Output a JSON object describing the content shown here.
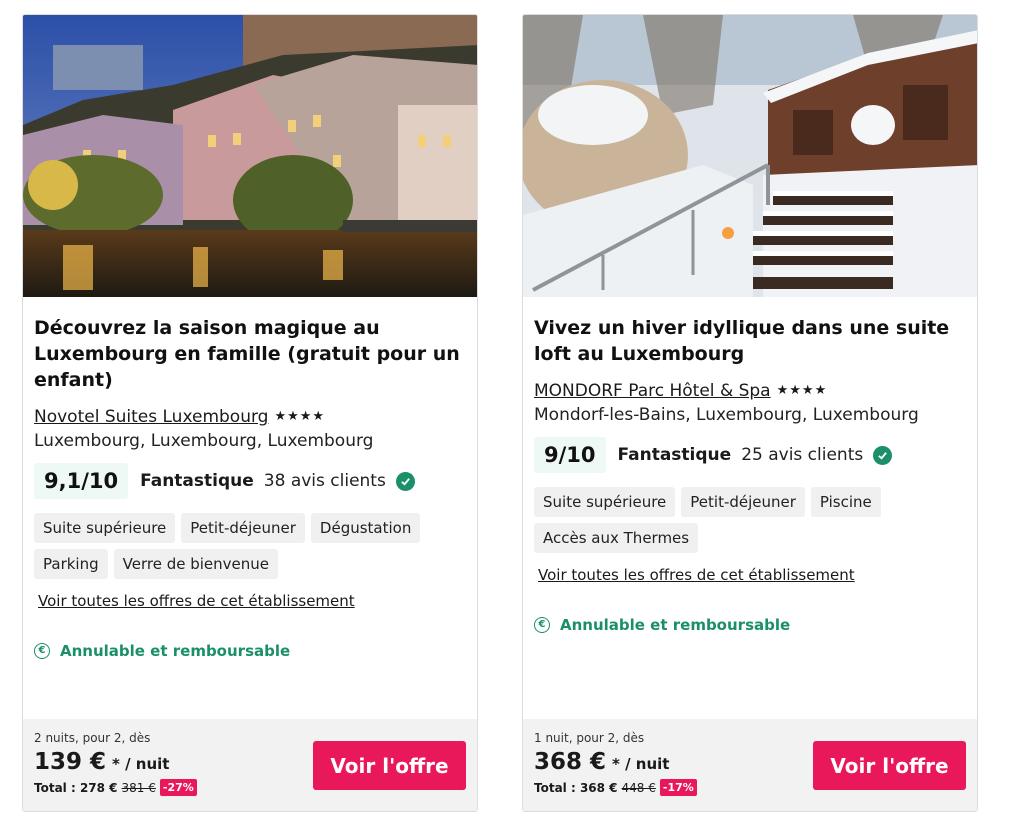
{
  "cards": [
    {
      "title": "Découvrez la saison magique au Luxembourg en famille (gratuit pour un enfant)",
      "hotel_name": "Novotel Suites Luxembourg",
      "stars": "★★★★",
      "location": "Luxembourg, Luxembourg, Luxembourg",
      "score": "9,1/10",
      "verdict": "Fantastique",
      "reviews": "38 avis clients",
      "tags": [
        "Suite supérieure",
        "Petit-déjeuner",
        "Dégustation",
        "Parking",
        "Verre de bienvenue"
      ],
      "offers_link": "Voir toutes les offres de cet établissement",
      "refund": "Annulable et remboursable",
      "stay": "2 nuits, pour 2, dès",
      "price": "139 €",
      "per_night": "* / nuit",
      "total_label": "Total : 278 €",
      "old_price": "381 €",
      "discount": "-27%",
      "cta": "Voir l'offre"
    },
    {
      "title": "Vivez un hiver idyllique dans une suite loft au Luxembourg",
      "hotel_name": "MONDORF Parc Hôtel & Spa",
      "stars": "★★★★",
      "location": "Mondorf-les-Bains, Luxembourg, Luxembourg",
      "score": "9/10",
      "verdict": "Fantastique",
      "reviews": "25 avis clients",
      "tags": [
        "Suite supérieure",
        "Petit-déjeuner",
        "Piscine",
        "Accès aux Thermes"
      ],
      "offers_link": "Voir toutes les offres de cet établissement",
      "refund": "Annulable et remboursable",
      "stay": "1 nuit, pour 2, dès",
      "price": "368 €",
      "per_night": "* / nuit",
      "total_label": "Total : 368 €",
      "old_price": "448 €",
      "discount": "-17%",
      "cta": "Voir l'offre"
    }
  ],
  "colors": {
    "accent": "#e8185a",
    "positive": "#1a8f6a",
    "score_bg": "#eef8f5"
  }
}
